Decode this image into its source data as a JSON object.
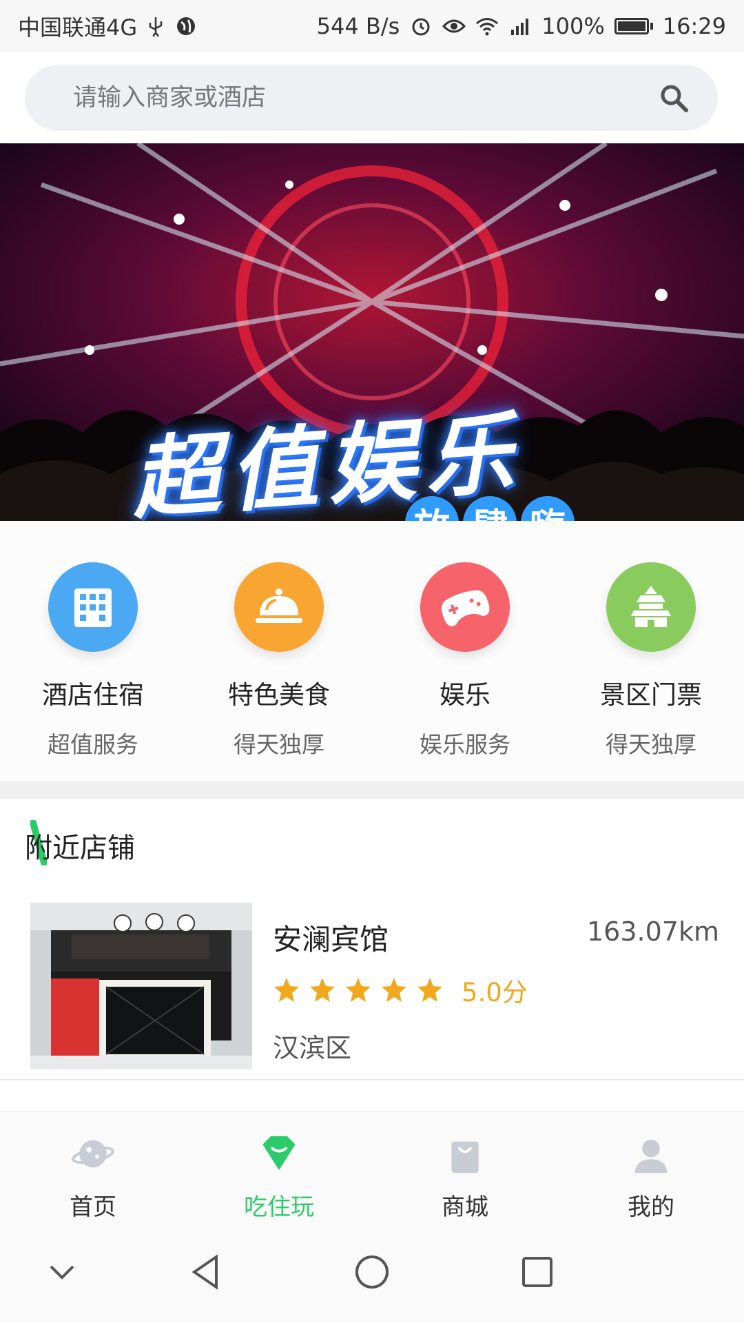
{
  "status_bar": {
    "carrier": "中国联通4G",
    "speed": "544 B/s",
    "battery": "100%",
    "time": "16:29"
  },
  "search": {
    "placeholder": "请输入商家或酒店",
    "icon": "search-icon"
  },
  "banner": {
    "title": "超值娱乐",
    "subtitle": [
      "放",
      "肆",
      "嗨"
    ],
    "pages": 2
  },
  "categories": [
    {
      "title": "酒店住宿",
      "subtitle": "超值服务",
      "icon": "building-icon",
      "color": "#4aa9f2"
    },
    {
      "title": "特色美食",
      "subtitle": "得天独厚",
      "icon": "food-cloche-icon",
      "color": "#f8a531"
    },
    {
      "title": "娱乐",
      "subtitle": "娱乐服务",
      "icon": "gamepad-icon",
      "color": "#f6636a"
    },
    {
      "title": "景区门票",
      "subtitle": "得天独厚",
      "icon": "temple-icon",
      "color": "#8acb5e"
    }
  ],
  "nearby": {
    "title": "附近店铺",
    "stores": [
      {
        "name": "安澜宾馆",
        "distance": "163.07km",
        "rating": 5,
        "score": "5.0分",
        "district": "汉滨区"
      }
    ]
  },
  "bottom_nav": [
    {
      "label": "首页",
      "icon": "planet-icon",
      "active": false
    },
    {
      "label": "吃住玩",
      "icon": "diamond-icon",
      "active": true
    },
    {
      "label": "商城",
      "icon": "shopping-bag-icon",
      "active": false
    },
    {
      "label": "我的",
      "icon": "user-icon",
      "active": false
    }
  ],
  "colors": {
    "accent": "#2ccb6a",
    "star": "#f0a81c"
  }
}
